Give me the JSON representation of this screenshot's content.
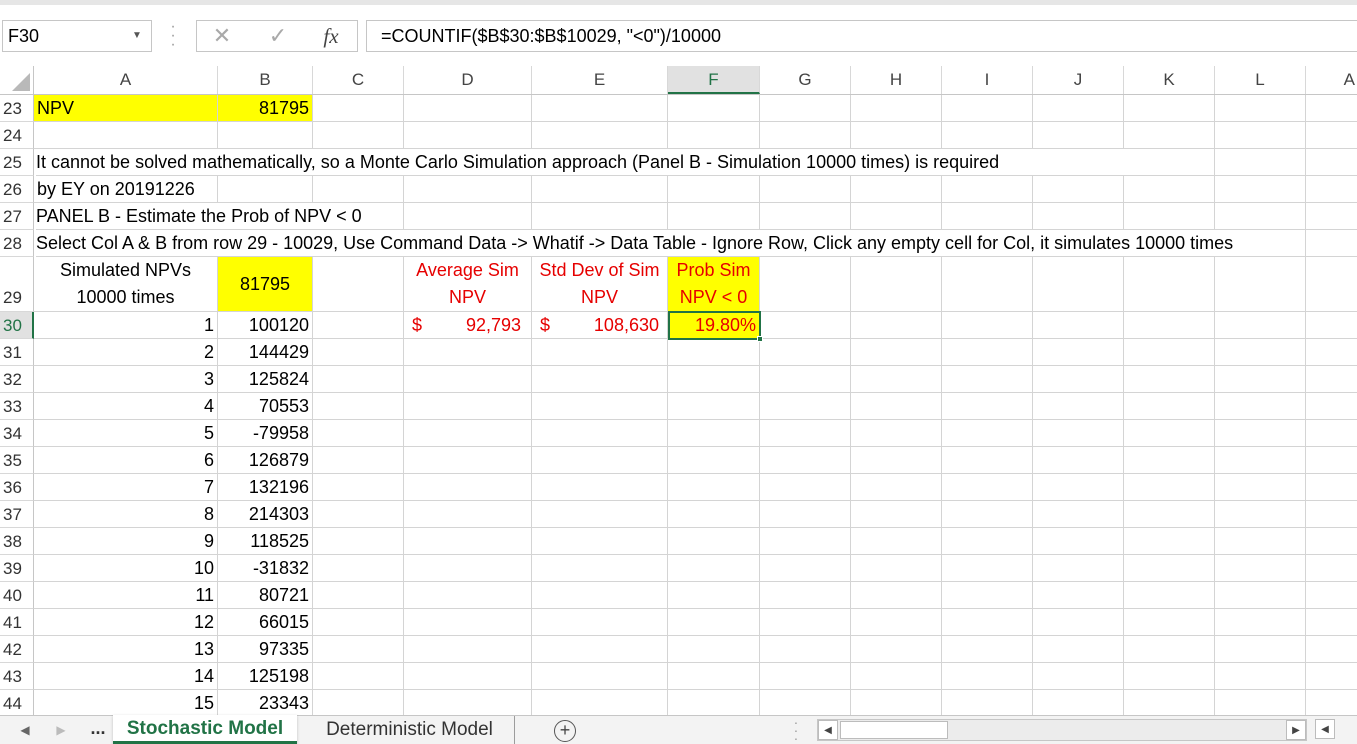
{
  "formula_bar": {
    "name_box": "F30",
    "cancel_icon": "✕",
    "enter_icon": "✓",
    "fx_label": "fx",
    "formula": "=COUNTIF($B$30:$B$10029, \"<0\")/10000"
  },
  "columns": [
    "A",
    "B",
    "C",
    "D",
    "E",
    "F",
    "G",
    "H",
    "I",
    "J",
    "K",
    "L",
    "A"
  ],
  "selected_column": "F",
  "selected_row": "30",
  "rows": {
    "r23": {
      "num": "23",
      "A": "NPV",
      "B": "81795"
    },
    "r24": {
      "num": "24"
    },
    "r25": {
      "num": "25",
      "text": "It cannot be solved mathematically, so a Monte Carlo Simulation approach (Panel B - Simulation 10000 times) is required"
    },
    "r26": {
      "num": "26",
      "text": "by EY on 20191226"
    },
    "r27": {
      "num": "27",
      "text": "PANEL B - Estimate the Prob of NPV < 0"
    },
    "r28": {
      "num": "28",
      "text": "Select Col A & B from row 29 - 10029, Use Command Data -> Whatif -> Data Table - Ignore Row, Click any empty cell for Col, it simulates 10000 times"
    },
    "r29": {
      "num": "29",
      "A_line1": "Simulated NPVs",
      "A_line2": "10000 times",
      "B": "81795",
      "D_line1": "Average Sim",
      "D_line2": "NPV",
      "E_line1": "Std Dev of Sim",
      "E_line2": "NPV",
      "F_line1": "Prob Sim",
      "F_line2": "NPV < 0"
    },
    "r30": {
      "num": "30",
      "A": "1",
      "B": "100120",
      "D_cur": "$",
      "D_val": "92,793",
      "E_cur": "$",
      "E_val": "108,630",
      "F": "19.80%"
    }
  },
  "sim_rows": [
    {
      "num": "31",
      "A": "2",
      "B": "144429"
    },
    {
      "num": "32",
      "A": "3",
      "B": "125824"
    },
    {
      "num": "33",
      "A": "4",
      "B": "70553"
    },
    {
      "num": "34",
      "A": "5",
      "B": "-79958"
    },
    {
      "num": "35",
      "A": "6",
      "B": "126879"
    },
    {
      "num": "36",
      "A": "7",
      "B": "132196"
    },
    {
      "num": "37",
      "A": "8",
      "B": "214303"
    },
    {
      "num": "38",
      "A": "9",
      "B": "118525"
    },
    {
      "num": "39",
      "A": "10",
      "B": "-31832"
    },
    {
      "num": "40",
      "A": "11",
      "B": "80721"
    },
    {
      "num": "41",
      "A": "12",
      "B": "66015"
    },
    {
      "num": "42",
      "A": "13",
      "B": "97335"
    },
    {
      "num": "43",
      "A": "14",
      "B": "125198"
    },
    {
      "num": "44",
      "A": "15",
      "B": "23343"
    }
  ],
  "sheet_tabs": {
    "more": "...",
    "active": "Stochastic Model",
    "second": "Deterministic Model",
    "add": "+"
  },
  "colors": {
    "highlight": "#ffff00",
    "red_text": "#e60000",
    "excel_green": "#217346"
  }
}
